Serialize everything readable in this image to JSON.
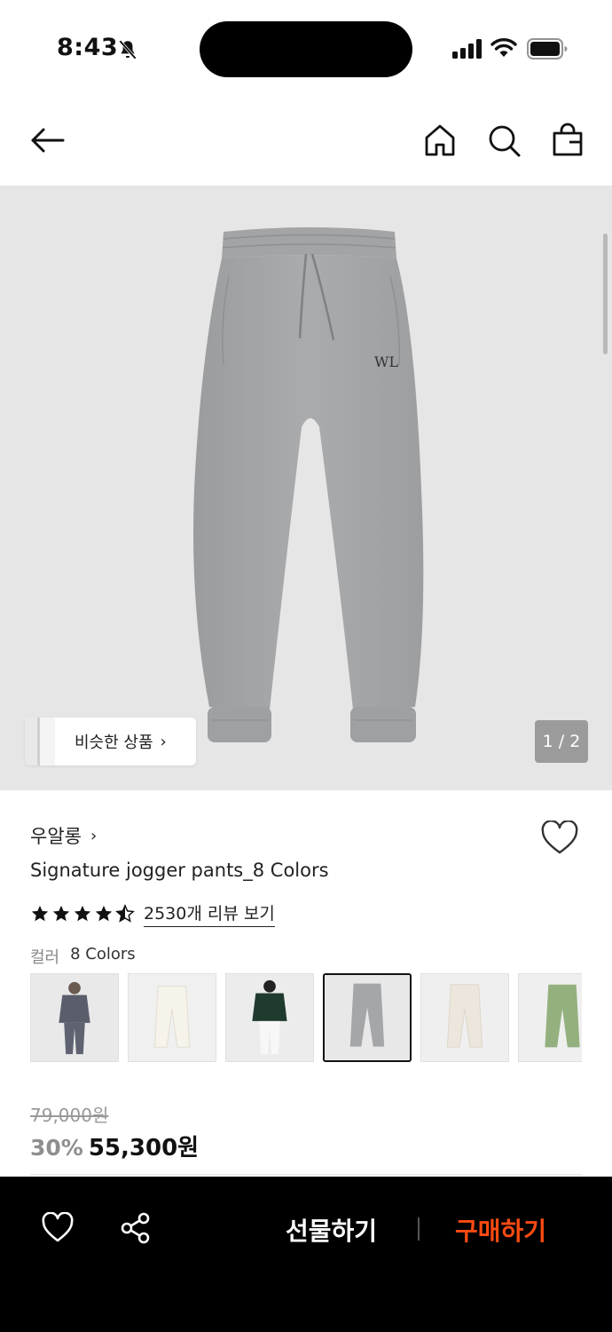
{
  "status_bar": {
    "time": "8:43"
  },
  "header": {
    "icons": [
      "back-arrow-icon",
      "home-icon",
      "search-icon",
      "shopping-bag-icon"
    ]
  },
  "gallery": {
    "similar_label": "비슷한 상품",
    "page_counter": "1 / 2",
    "background": "#e6e6e7"
  },
  "product": {
    "brand": "우알롱",
    "title": "Signature jogger pants_8 Colors",
    "rating": 4.5,
    "review_link": "2530개 리뷰 보기",
    "color_label": "컬러",
    "color_count": "8 Colors",
    "swatches": [
      {
        "name": "charcoal-set",
        "color": "#5a5d6b"
      },
      {
        "name": "ivory",
        "color": "#f3efe4"
      },
      {
        "name": "green-jacket-white-pants",
        "color": "#1f3b2e"
      },
      {
        "name": "melange-gray",
        "color": "#a4a6a8",
        "selected": true
      },
      {
        "name": "oatmeal",
        "color": "#ece6dc"
      },
      {
        "name": "sage-green",
        "color": "#94b07e"
      }
    ],
    "original_price": "79,000원",
    "discount": "30%",
    "price": "55,300원"
  },
  "bottom_bar": {
    "gift_label": "선물하기",
    "buy_label": "구매하기",
    "accent": "#ff4b12"
  }
}
